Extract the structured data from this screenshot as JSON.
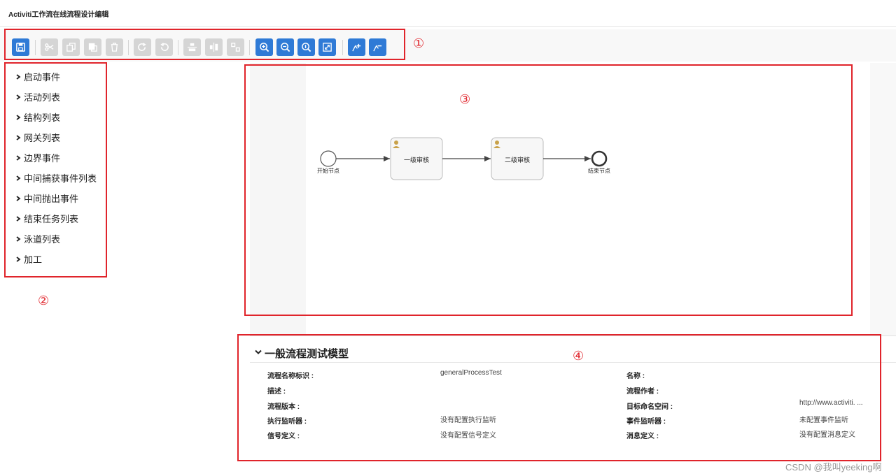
{
  "app": {
    "title": "Activiti工作流在线流程设计编辑"
  },
  "annotations": {
    "n1": "①",
    "n2": "②",
    "n3": "③",
    "n4": "④"
  },
  "toolbar": {
    "buttons": [
      {
        "icon": "save-icon",
        "state": "active"
      },
      {
        "icon": "cut-icon",
        "state": "disabled"
      },
      {
        "icon": "copy-icon",
        "state": "disabled"
      },
      {
        "icon": "paste-icon",
        "state": "disabled"
      },
      {
        "icon": "delete-icon",
        "state": "disabled"
      },
      {
        "icon": "redo-icon",
        "state": "disabled"
      },
      {
        "icon": "undo-icon",
        "state": "disabled"
      },
      {
        "icon": "align-horizontal-icon",
        "state": "disabled"
      },
      {
        "icon": "align-vertical-icon",
        "state": "disabled"
      },
      {
        "icon": "same-size-icon",
        "state": "disabled"
      },
      {
        "icon": "zoom-in-icon",
        "state": "active"
      },
      {
        "icon": "zoom-out-icon",
        "state": "active"
      },
      {
        "icon": "zoom-actual-icon",
        "state": "active"
      },
      {
        "icon": "zoom-fit-icon",
        "state": "active"
      },
      {
        "icon": "add-bendpoint-icon",
        "state": "active"
      },
      {
        "icon": "remove-bendpoint-icon",
        "state": "active"
      }
    ]
  },
  "palette": {
    "items": [
      "启动事件",
      "活动列表",
      "结构列表",
      "网关列表",
      "边界事件",
      "中间捕获事件列表",
      "中间抛出事件",
      "结束任务列表",
      "泳道列表",
      "加工"
    ]
  },
  "diagram": {
    "start_label": "开始节点",
    "task1_label": "一级审核",
    "task2_label": "二级审核",
    "end_label": "结束节点"
  },
  "properties": {
    "title": "一般流程测试模型",
    "left_labels": [
      "流程名称标识 :",
      "描述 :",
      "流程版本 :",
      "执行监听器 :",
      "信号定义 :"
    ],
    "left_values": [
      "generalProcessTest",
      "",
      "",
      "没有配置执行监听",
      "没有配置信号定义"
    ],
    "right_labels": [
      "名称 :",
      "流程作者 :",
      "目标命名空间 :",
      "事件监听器 :",
      "消息定义 :"
    ],
    "right_values": [
      "",
      "",
      "http://www.activiti. ...",
      "未配置事件监听",
      "没有配置消息定义"
    ]
  },
  "watermark": "CSDN @我叫yeeking啊",
  "colors": {
    "accent": "#2f7ad6",
    "annotation": "#e0242b",
    "disabled": "#d5d5d5"
  }
}
